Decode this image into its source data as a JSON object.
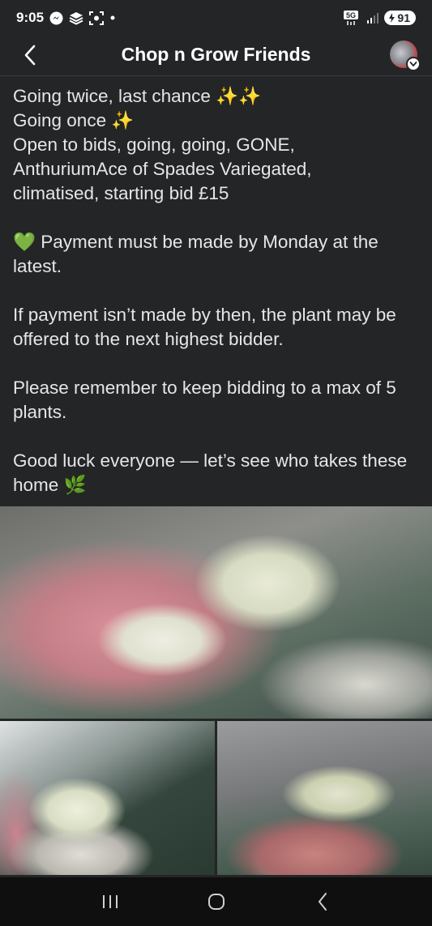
{
  "status_bar": {
    "time": "9:05",
    "network": "5G",
    "battery": "91"
  },
  "header": {
    "title": "Chop n Grow Friends"
  },
  "post": {
    "lines": [
      "Going twice, last chance ✨✨",
      "Going once ✨",
      "Open to bids, going, going, GONE,",
      "AnthuriumAce of Spades Variegated,",
      "climatised, starting bid £15"
    ],
    "payment": "💚 Payment must be made by Monday at the latest.",
    "next_bidder": "If payment isn’t made by then, the plant may be offered to the next highest bidder.",
    "reminder": "Please remember to keep bidding to a max of 5 plants.",
    "good_luck": "Good luck everyone — let’s see who takes these home 🌿"
  },
  "colors": {
    "background": "#242526",
    "text": "#e4e6eb",
    "nav_bar": "#0f0f10"
  }
}
